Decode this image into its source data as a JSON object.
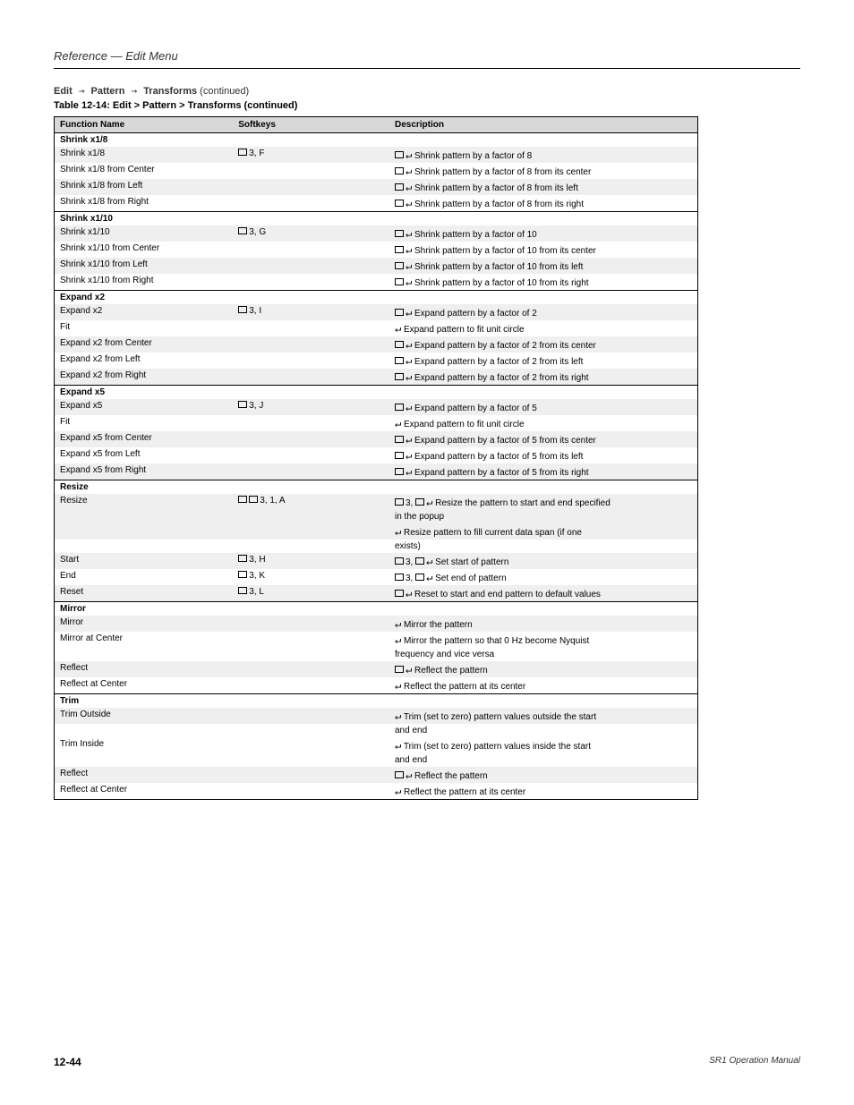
{
  "header": {
    "chapter": "Reference — Edit Menu",
    "crumb_a": "Edit",
    "crumb_b": "Pattern",
    "crumb_c": "Transforms",
    "crumb_cont": " (continued)"
  },
  "table": {
    "title_prefix": "Table 12-14: ",
    "title": "Edit > Pattern > Transforms",
    "title_cont": " (continued)",
    "columns": [
      "Function Name",
      "Softkeys",
      "Description"
    ]
  },
  "sections": [
    {
      "label": "Shrink x1/8",
      "rows": [
        {
          "name": "Shrink x1/8",
          "sk": "3, F",
          "desc": "Shrink pattern by a factor of 8"
        },
        {
          "name": "Shrink x1/8 from Center",
          "desc": "Shrink pattern by a factor of 8 from its center"
        },
        {
          "name": "Shrink x1/8 from Left",
          "desc": "Shrink pattern by a factor of 8 from its left"
        },
        {
          "name": "Shrink x1/8 from Right",
          "desc": "Shrink pattern by a factor of 8 from its right"
        }
      ]
    },
    {
      "label": "Shrink x1/10",
      "rows": [
        {
          "name": "Shrink x1/10",
          "sk": "3, G",
          "desc": "Shrink pattern by a factor of 10"
        },
        {
          "name": "Shrink x1/10 from Center",
          "desc": "Shrink pattern by a factor of 10 from its center"
        },
        {
          "name": "Shrink x1/10 from Left",
          "desc": "Shrink pattern by a factor of 10 from its left"
        },
        {
          "name": "Shrink x1/10 from Right",
          "desc": "Shrink pattern by a factor of 10 from its right"
        }
      ]
    },
    {
      "label": "Expand x2",
      "rows": [
        {
          "name": "Expand x2",
          "sk": "3, I",
          "desc": "Expand pattern by a factor of 2"
        },
        {
          "name": "Fit",
          "desc": "Expand pattern to fit unit circle"
        },
        {
          "name": "Expand x2 from Center",
          "desc": "Expand pattern by a factor of 2 from its center"
        },
        {
          "name": "Expand x2 from Left",
          "desc": "Expand pattern by a factor of 2 from its left"
        },
        {
          "name": "Expand x2 from Right",
          "desc": "Expand pattern by a factor of 2 from its right"
        }
      ]
    },
    {
      "label": "Expand x5",
      "rows": [
        {
          "name": "Expand x5",
          "sk": "3, J",
          "desc": "Expand pattern by a factor of 5"
        },
        {
          "name": "Fit",
          "desc": "Expand pattern to fit unit circle"
        },
        {
          "name": "Expand x5 from Center",
          "desc": "Expand pattern by a factor of 5 from its center"
        },
        {
          "name": "Expand x5 from Left",
          "desc": "Expand pattern by a factor of 5 from its left"
        },
        {
          "name": "Expand x5 from Right",
          "desc": "Expand pattern by a factor of 5 from its right"
        }
      ]
    },
    {
      "label": "Resize",
      "rows": [
        {
          "name": "Resize",
          "sk": "3, 1, A",
          "desc_a": "3, ",
          "desc": "Resize the pattern to start and end specified",
          "desc2": "in the popup",
          "desc3": "Resize pattern to fill current data span (if one",
          "desc4": "exists)"
        },
        {
          "name": "Start",
          "sk": "3, H",
          "desc_a": "3, ",
          "desc": "Set start of pattern"
        },
        {
          "name": "End",
          "sk": "3, K",
          "desc_a": "3, ",
          "desc": "Set end of pattern"
        },
        {
          "name": "Reset",
          "sk": "3, L",
          "desc": "Reset to start and end pattern to default values"
        }
      ]
    },
    {
      "label": "Mirror",
      "rows": [
        {
          "name": "Mirror",
          "desc": "Mirror the pattern"
        },
        {
          "name": "Mirror at Center",
          "desc": "Mirror the pattern so that 0 Hz become Nyquist",
          "desc2": "frequency and vice versa"
        },
        {
          "name": "Reflect",
          "desc": "Reflect the pattern"
        },
        {
          "name": "Reflect at Center",
          "desc": "Reflect the pattern at its center"
        }
      ]
    },
    {
      "label": "Trim",
      "rows": [
        {
          "name": "Trim Outside",
          "desc": "Trim (set to zero) pattern values outside the start",
          "desc2": "and end"
        },
        {
          "name": "Trim Inside",
          "desc": "Trim (set to zero) pattern values inside the start",
          "desc2": "and end"
        },
        {
          "name": "Reflect",
          "desc": "Reflect the pattern"
        },
        {
          "name": "Reflect at Center",
          "desc": "Reflect the pattern at its center"
        }
      ]
    }
  ],
  "footer": {
    "page": "12-44",
    "text": "SR1 Operation Manual"
  }
}
